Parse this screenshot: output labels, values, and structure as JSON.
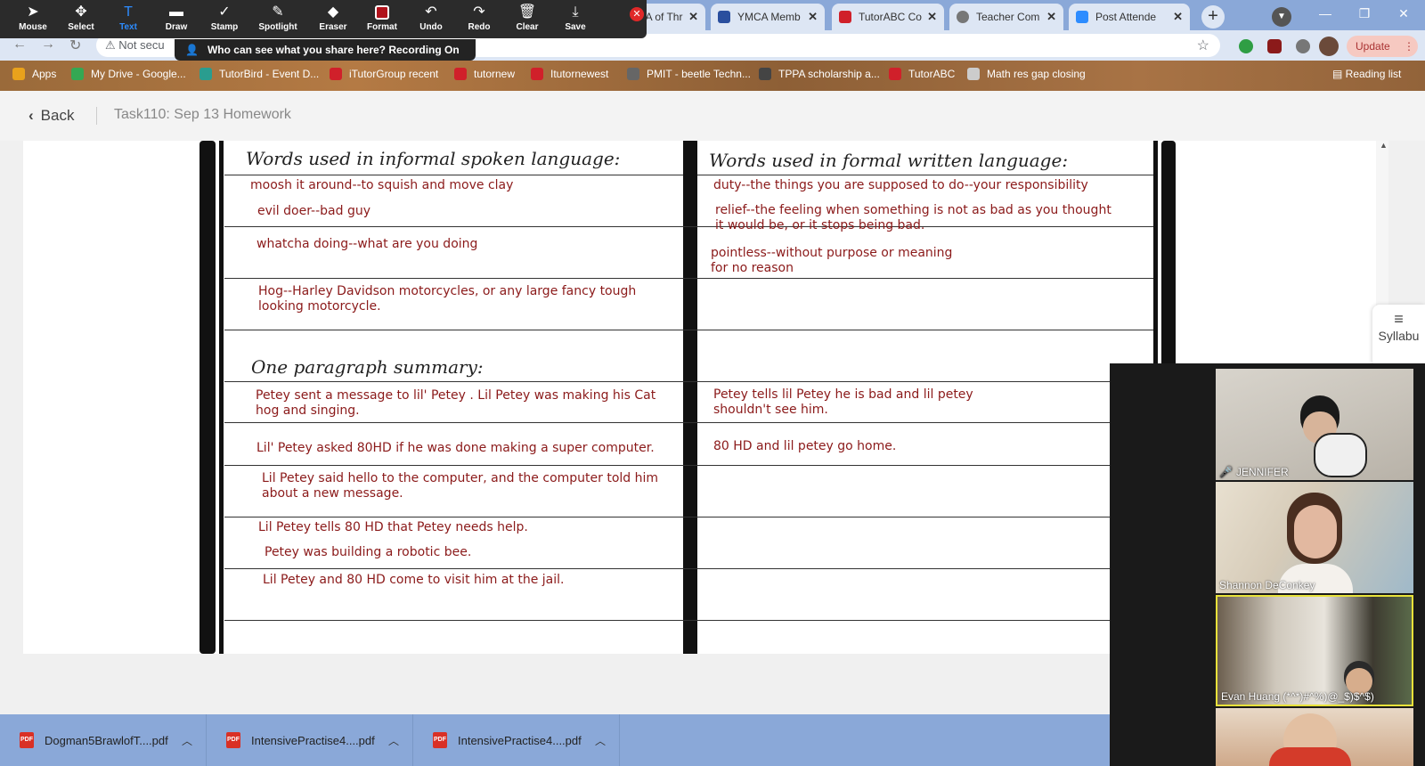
{
  "annotate_toolbar": {
    "tools": [
      {
        "name": "mouse",
        "label": "Mouse",
        "icon": "arrow-pointer-icon",
        "glyph": "➤"
      },
      {
        "name": "select",
        "label": "Select",
        "icon": "move-arrows-icon",
        "glyph": "✥"
      },
      {
        "name": "text",
        "label": "Text",
        "icon": "text-t-icon",
        "glyph": "T"
      },
      {
        "name": "draw",
        "label": "Draw",
        "icon": "pen-draw-icon",
        "glyph": "▬"
      },
      {
        "name": "stamp",
        "label": "Stamp",
        "icon": "checkmark-stamp-icon",
        "glyph": "✓"
      },
      {
        "name": "spotlight",
        "label": "Spotlight",
        "icon": "spotlight-wand-icon",
        "glyph": "✎"
      },
      {
        "name": "eraser",
        "label": "Eraser",
        "icon": "eraser-icon",
        "glyph": "◆"
      },
      {
        "name": "format",
        "label": "Format",
        "icon": "format-swatch-icon",
        "glyph": ""
      },
      {
        "name": "undo",
        "label": "Undo",
        "icon": "undo-icon",
        "glyph": "↶"
      },
      {
        "name": "redo",
        "label": "Redo",
        "icon": "redo-icon",
        "glyph": "↷"
      },
      {
        "name": "clear",
        "label": "Clear",
        "icon": "trash-icon",
        "glyph": "🗑"
      },
      {
        "name": "save",
        "label": "Save",
        "icon": "save-download-icon",
        "glyph": "⤓"
      }
    ],
    "active_tool": "Text",
    "format_color": "#b0121b"
  },
  "share_banner": {
    "text": "Who can see what you share here? Recording On"
  },
  "tabs": [
    {
      "label": "CA of Thr",
      "favicon_color": "#888888"
    },
    {
      "label": "YMCA Memb",
      "favicon_color": "#2a4f9e"
    },
    {
      "label": "TutorABC Co",
      "favicon_color": "#d0202a"
    },
    {
      "label": "Teacher Com",
      "favicon_color": "#777777"
    },
    {
      "label": "Post Attende",
      "favicon_color": "#2d8cff"
    }
  ],
  "omnibar": {
    "not_secure": "Not secu",
    "update_label": "Update"
  },
  "bookmarks": [
    {
      "label": "Apps",
      "icon_color": "#e9a21c"
    },
    {
      "label": "My Drive - Google...",
      "icon_color": "#34a853"
    },
    {
      "label": "TutorBird - Event D...",
      "icon_color": "#2a9d8f"
    },
    {
      "label": "iTutorGroup recent",
      "icon_color": "#d0202a"
    },
    {
      "label": "tutornew",
      "icon_color": "#d0202a"
    },
    {
      "label": "Itutornewest",
      "icon_color": "#d0202a"
    },
    {
      "label": "PMIT - beetle Techn...",
      "icon_color": "#666666"
    },
    {
      "label": "TPPA scholarship a...",
      "icon_color": "#444444"
    },
    {
      "label": "TutorABC",
      "icon_color": "#d0202a"
    },
    {
      "label": "Math res gap closing",
      "icon_color": "#cccccc"
    }
  ],
  "bookmarks_reading": "Reading list",
  "page": {
    "back_label": "Back",
    "title": "Task110:  Sep 13 Homework"
  },
  "worksheet": {
    "left_header": "Words used in informal spoken language:",
    "right_header": "Words used in formal written language:",
    "summary_header": "One paragraph summary:",
    "left_rows": [
      "moosh it around--to squish and move clay",
      "evil doer--bad guy",
      "whatcha doing--what are you doing",
      "Hog--Harley Davidson motorcycles, or any large fancy tough\nlooking motorcycle."
    ],
    "right_rows": [
      "duty--the things you are supposed to do--your responsibility",
      "relief--the feeling when something is not as bad as you thought\nit would be, or it stops being bad.",
      "pointless--without purpose or meaning\nfor no reason"
    ],
    "summary_left": [
      "Petey sent a message to lil' Petey .  Lil Petey was making his Cat\nhog and singing.",
      "Lil' Petey asked 80HD if he was done making a super computer.",
      "Lil Petey said hello to the computer, and the computer told him\nabout a new message.",
      "Lil Petey tells 80 HD that Petey needs help.",
      "Petey was building a robotic bee.",
      "Lil Petey and 80 HD come to visit him at the jail."
    ],
    "summary_right": [
      "Petey tells lil Petey he is bad and lil petey\nshouldn't see him.",
      "80 HD and lil petey go home."
    ]
  },
  "syllabus": {
    "label": "Syllabu"
  },
  "video": {
    "participants": [
      {
        "name": "JENNIFER",
        "muted": true
      },
      {
        "name": "Shannon DeConkey",
        "muted": false
      },
      {
        "name": "Evan Huang (*^*)#^%)@_$)$^$)",
        "muted": false,
        "active_speaker": true
      },
      {
        "name": "",
        "muted": false
      }
    ]
  },
  "downloads": [
    {
      "name": "Dogman5BrawlofT....pdf"
    },
    {
      "name": "IntensivePractise4....pdf"
    },
    {
      "name": "IntensivePractise4....pdf"
    }
  ]
}
